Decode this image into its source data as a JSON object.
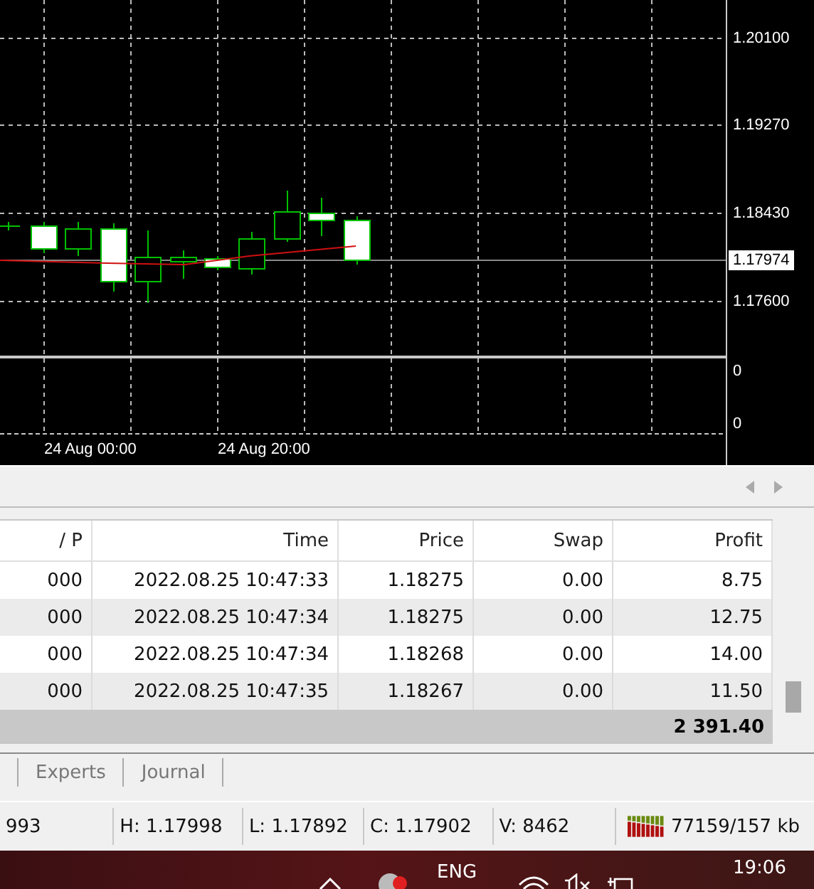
{
  "chart": {
    "price_labels": [
      "1.20100",
      "1.19270",
      "1.18430",
      "1.17600"
    ],
    "current_price": "1.17974",
    "indicator_labels": [
      "0",
      "0"
    ],
    "time_labels": [
      "24 Aug 00:00",
      "24 Aug 20:00"
    ]
  },
  "table": {
    "columns": [
      "/ P",
      "Time",
      "Price",
      "Swap",
      "Profit"
    ],
    "rows": [
      [
        "000",
        "2022.08.25 10:47:33",
        "1.18275",
        "0.00",
        "8.75"
      ],
      [
        "000",
        "2022.08.25 10:47:34",
        "1.18275",
        "0.00",
        "12.75"
      ],
      [
        "000",
        "2022.08.25 10:47:34",
        "1.18268",
        "0.00",
        "14.00"
      ],
      [
        "000",
        "2022.08.25 10:47:35",
        "1.18267",
        "0.00",
        "11.50"
      ]
    ],
    "total": "2 391.40"
  },
  "tabs": [
    {
      "label": "Experts",
      "selected": false
    },
    {
      "label": "Journal",
      "selected": false
    }
  ],
  "status_bar": [
    "993",
    "H: 1.17998",
    "L: 1.17892",
    "C: 1.17902",
    "V: 8462"
  ],
  "traffic": "77159/157 kb",
  "taskbar": {
    "language": "ENG",
    "clock": "19:06"
  }
}
